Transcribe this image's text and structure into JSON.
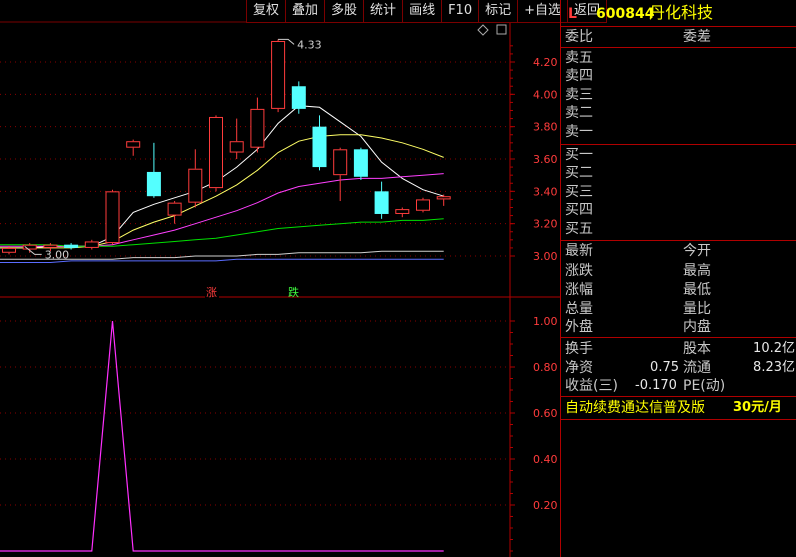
{
  "toolbar": {
    "buttons": [
      "复权",
      "叠加",
      "多股",
      "统计",
      "画线",
      "F10",
      "标记",
      "+自选",
      "返回"
    ]
  },
  "header": {
    "mark": "L",
    "code": "600844",
    "name": "丹化科技"
  },
  "order_book": {
    "ratio_label": "委比",
    "diff_label": "委差",
    "sells": [
      "卖五",
      "卖四",
      "卖三",
      "卖二",
      "卖一"
    ],
    "buys": [
      "买一",
      "买二",
      "买三",
      "买四",
      "买五"
    ]
  },
  "quote": {
    "latest": "最新",
    "open": "今开",
    "change": "涨跌",
    "high": "最高",
    "pct": "涨幅",
    "low": "最低",
    "volume": "总量",
    "vol_ratio": "量比",
    "outer": "外盘",
    "inner": "内盘"
  },
  "stats": {
    "turnover_label": "换手",
    "capital_label": "股本",
    "capital_value": "10.2亿",
    "nav_label": "净资",
    "nav_value": "0.75",
    "float_label": "流通",
    "float_value": "8.23亿",
    "eps_label": "收益(三)",
    "eps_value": "-0.170",
    "pe_label": "PE(动)"
  },
  "promo": {
    "text": "自动续费通达信普及版",
    "price": "30元/月"
  },
  "chart_data": {
    "type": "candlestick",
    "price_axis": {
      "ticks": [
        "4.20",
        "4.00",
        "3.80",
        "3.60",
        "3.40",
        "3.20",
        "3.00"
      ],
      "range": [
        2.96,
        4.38
      ]
    },
    "markers": {
      "up": "涨",
      "down": "跌"
    },
    "annotations": {
      "high": "4.33",
      "low": "3.00"
    },
    "candles": [
      {
        "o": 3.02,
        "c": 3.05,
        "h": 3.06,
        "l": 3.01
      },
      {
        "o": 3.04,
        "c": 3.07,
        "h": 3.08,
        "l": 3.02
      },
      {
        "o": 3.05,
        "c": 3.07,
        "h": 3.08,
        "l": 3.03
      },
      {
        "o": 3.07,
        "c": 3.05,
        "h": 3.08,
        "l": 3.04
      },
      {
        "o": 3.05,
        "c": 3.09,
        "h": 3.1,
        "l": 3.04
      },
      {
        "o": 3.08,
        "c": 3.4,
        "h": 3.41,
        "l": 3.07
      },
      {
        "o": 3.67,
        "c": 3.71,
        "h": 3.72,
        "l": 3.62
      },
      {
        "o": 3.52,
        "c": 3.37,
        "h": 3.7,
        "l": 3.36
      },
      {
        "o": 3.25,
        "c": 3.33,
        "h": 3.34,
        "l": 3.2
      },
      {
        "o": 3.33,
        "c": 3.54,
        "h": 3.66,
        "l": 3.3
      },
      {
        "o": 3.42,
        "c": 3.86,
        "h": 3.87,
        "l": 3.4
      },
      {
        "o": 3.64,
        "c": 3.71,
        "h": 3.85,
        "l": 3.6
      },
      {
        "o": 3.67,
        "c": 3.91,
        "h": 3.98,
        "l": 3.64
      },
      {
        "o": 3.91,
        "c": 4.33,
        "h": 4.34,
        "l": 3.89
      },
      {
        "o": 4.05,
        "c": 3.91,
        "h": 4.08,
        "l": 3.88
      },
      {
        "o": 3.8,
        "c": 3.55,
        "h": 3.87,
        "l": 3.53
      },
      {
        "o": 3.5,
        "c": 3.66,
        "h": 3.67,
        "l": 3.34
      },
      {
        "o": 3.66,
        "c": 3.49,
        "h": 3.67,
        "l": 3.47
      },
      {
        "o": 3.4,
        "c": 3.26,
        "h": 3.46,
        "l": 3.23
      },
      {
        "o": 3.26,
        "c": 3.29,
        "h": 3.3,
        "l": 3.24
      },
      {
        "o": 3.28,
        "c": 3.35,
        "h": 3.36,
        "l": 3.27
      },
      {
        "o": 3.35,
        "c": 3.37,
        "h": 3.38,
        "l": 3.31
      }
    ],
    "ma": [
      {
        "color": "#ffffff",
        "values": [
          3.05,
          3.05,
          3.06,
          3.06,
          3.06,
          3.12,
          3.27,
          3.32,
          3.36,
          3.4,
          3.46,
          3.55,
          3.66,
          3.82,
          3.93,
          3.92,
          3.83,
          3.74,
          3.58,
          3.48,
          3.41,
          3.37
        ]
      },
      {
        "color": "#ffff66",
        "values": [
          3.05,
          3.05,
          3.05,
          3.05,
          3.06,
          3.09,
          3.16,
          3.21,
          3.25,
          3.31,
          3.37,
          3.44,
          3.53,
          3.64,
          3.71,
          3.74,
          3.75,
          3.75,
          3.73,
          3.7,
          3.66,
          3.61
        ]
      },
      {
        "color": "#ff40ff",
        "values": [
          3.06,
          3.06,
          3.06,
          3.06,
          3.06,
          3.07,
          3.1,
          3.13,
          3.16,
          3.2,
          3.24,
          3.28,
          3.33,
          3.39,
          3.43,
          3.45,
          3.47,
          3.48,
          3.48,
          3.49,
          3.5,
          3.51
        ]
      },
      {
        "color": "#00e000",
        "values": [
          3.07,
          3.07,
          3.07,
          3.06,
          3.06,
          3.06,
          3.07,
          3.08,
          3.09,
          3.1,
          3.11,
          3.13,
          3.15,
          3.17,
          3.18,
          3.19,
          3.2,
          3.21,
          3.21,
          3.22,
          3.22,
          3.23
        ]
      },
      {
        "color": "#d0d0d0",
        "values": [
          2.98,
          2.98,
          2.98,
          2.98,
          2.98,
          2.98,
          2.99,
          2.99,
          2.99,
          3.0,
          3.0,
          3.0,
          3.01,
          3.01,
          3.02,
          3.02,
          3.02,
          3.02,
          3.03,
          3.03,
          3.03,
          3.03
        ]
      },
      {
        "color": "#5a6cff",
        "values": [
          2.96,
          2.96,
          2.96,
          2.97,
          2.97,
          2.97,
          2.97,
          2.97,
          2.97,
          2.97,
          2.97,
          2.98,
          2.98,
          2.98,
          2.98,
          2.98,
          2.98,
          2.98,
          2.98,
          2.98,
          2.98,
          2.98
        ]
      }
    ],
    "indicator": {
      "ticks": [
        "1.00",
        "0.80",
        "0.60",
        "0.40",
        "0.20"
      ],
      "range": [
        -0.2,
        1.1
      ],
      "color": "#ff30ff",
      "values": [
        0,
        0,
        0,
        0,
        0,
        1,
        0,
        0,
        0,
        0,
        0,
        0,
        0,
        0,
        0,
        0,
        0,
        0,
        0,
        0,
        0,
        0
      ]
    }
  }
}
